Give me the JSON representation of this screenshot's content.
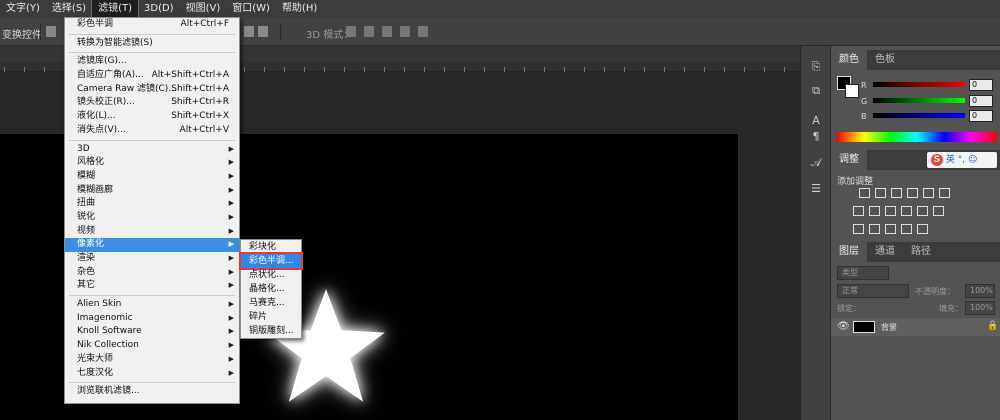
{
  "menubar": [
    "文字(Y)",
    "选择(S)",
    "滤镜(T)",
    "3D(D)",
    "视图(V)",
    "窗口(W)",
    "帮助(H)"
  ],
  "menubar_active": "滤镜(T)",
  "options_bar": {
    "left_label": "变换控件",
    "mode_3d_label": "3D 模式："
  },
  "filter_menu": {
    "items": [
      {
        "label": "彩色半调",
        "shortcut": "Alt+Ctrl+F"
      },
      {
        "sep": true
      },
      {
        "label": "转换为智能滤镜(S)"
      },
      {
        "sep": true
      },
      {
        "label": "滤镜库(G)..."
      },
      {
        "label": "自适应广角(A)...",
        "shortcut": "Alt+Shift+Ctrl+A"
      },
      {
        "label": "Camera Raw 滤镜(C)...",
        "shortcut": "Shift+Ctrl+A"
      },
      {
        "label": "镜头校正(R)...",
        "shortcut": "Shift+Ctrl+R"
      },
      {
        "label": "液化(L)...",
        "shortcut": "Shift+Ctrl+X"
      },
      {
        "label": "消失点(V)...",
        "shortcut": "Alt+Ctrl+V"
      },
      {
        "sep": true
      },
      {
        "label": "3D",
        "submenu": true
      },
      {
        "label": "风格化",
        "submenu": true
      },
      {
        "label": "模糊",
        "submenu": true
      },
      {
        "label": "模糊画廊",
        "submenu": true
      },
      {
        "label": "扭曲",
        "submenu": true
      },
      {
        "label": "锐化",
        "submenu": true
      },
      {
        "label": "视频",
        "submenu": true
      },
      {
        "label": "像素化",
        "submenu": true,
        "highlighted": true
      },
      {
        "label": "渲染",
        "submenu": true
      },
      {
        "label": "杂色",
        "submenu": true
      },
      {
        "label": "其它",
        "submenu": true
      },
      {
        "sep": true
      },
      {
        "label": "Alien Skin",
        "submenu": true
      },
      {
        "label": "Imagenomic",
        "submenu": true
      },
      {
        "label": "Knoll Software",
        "submenu": true
      },
      {
        "label": "Nik Collection",
        "submenu": true
      },
      {
        "label": "光束大师",
        "submenu": true
      },
      {
        "label": "七度汉化",
        "submenu": true
      },
      {
        "sep": true
      },
      {
        "label": "浏览联机滤镜..."
      }
    ]
  },
  "pixelate_submenu": {
    "items": [
      {
        "label": "彩块化"
      },
      {
        "label": "彩色半调...",
        "selected": true
      },
      {
        "label": "点状化..."
      },
      {
        "label": "晶格化..."
      },
      {
        "label": "马赛克..."
      },
      {
        "label": "碎片"
      },
      {
        "label": "铜版雕刻..."
      }
    ]
  },
  "color_panel": {
    "tabs": [
      "颜色",
      "色板"
    ],
    "rows": [
      {
        "label": "R",
        "value": "0"
      },
      {
        "label": "G",
        "value": "0"
      },
      {
        "label": "B",
        "value": "0"
      }
    ]
  },
  "adjust_panel": {
    "tab": "调整",
    "add_label": "添加调整",
    "ime_text": "英"
  },
  "layers_panel": {
    "tabs": [
      "图层",
      "通道",
      "路径"
    ],
    "kind_placeholder": "类型",
    "blend_mode": "正常",
    "opacity_label": "不透明度：",
    "opacity_value": "100%",
    "lock_label": "锁定：",
    "fill_label": "填充：",
    "fill_value": "100%",
    "layer_name": "背景"
  },
  "colors": {
    "accent": "#3a8ee6",
    "selection_outline": "#e23b3b"
  }
}
